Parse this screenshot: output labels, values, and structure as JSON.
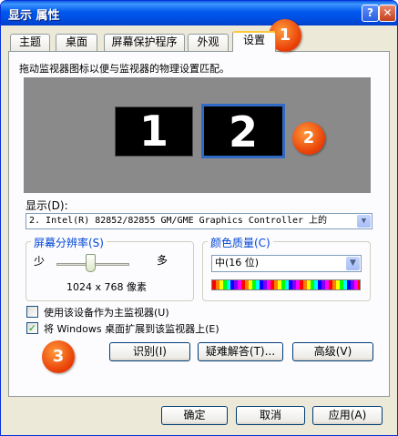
{
  "window": {
    "title": "显示 属性",
    "help_glyph": "?",
    "close_glyph": "✕"
  },
  "tabs": [
    {
      "label": "主题"
    },
    {
      "label": "桌面"
    },
    {
      "label": "屏幕保护程序"
    },
    {
      "label": "外观"
    },
    {
      "label": "设置",
      "active": true
    }
  ],
  "settings": {
    "instruction": "拖动监视器图标以便与监视器的物理设置匹配。",
    "monitors": [
      "1",
      "2"
    ],
    "display_label": "显示(D):",
    "display_value": "2. Intel(R) 82852/82855 GM/GME Graphics Controller 上的",
    "resolution": {
      "group_label": "屏幕分辨率(S)",
      "less": "少",
      "more": "多",
      "value": "1024 x 768 像素"
    },
    "color": {
      "group_label": "颜色质量(C)",
      "value": "中(16 位)"
    },
    "checkbox_primary": {
      "label": "使用该设备作为主监视器(U)",
      "checked": false
    },
    "checkbox_extend": {
      "label": "将 Windows 桌面扩展到该监视器上(E)",
      "checked": true
    },
    "buttons": {
      "identify": "识别(I)",
      "troubleshoot": "疑难解答(T)...",
      "advanced": "高级(V)"
    }
  },
  "footer": {
    "ok": "确定",
    "cancel": "取消",
    "apply": "应用(A)"
  },
  "badges": [
    "1",
    "2",
    "3"
  ],
  "colors": {
    "titlebar": "#0058ee",
    "badge": "#e83c05",
    "selected_monitor_border": "#316ac5"
  }
}
